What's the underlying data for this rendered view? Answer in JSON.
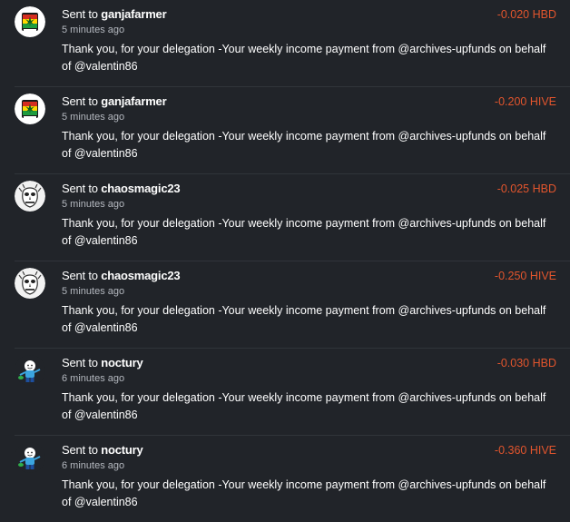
{
  "transactions": [
    {
      "prefix": "Sent to",
      "recipient": "ganjafarmer",
      "time": "5 minutes ago",
      "amount": "-0.020 HBD",
      "memo": "Thank you, for your delegation -Your weekly income payment from @archives-upfunds on behalf of @valentin86",
      "avatar": "ganjafarmer-avatar"
    },
    {
      "prefix": "Sent to",
      "recipient": "ganjafarmer",
      "time": "5 minutes ago",
      "amount": "-0.200 HIVE",
      "memo": "Thank you, for your delegation -Your weekly income payment from @archives-upfunds on behalf of @valentin86",
      "avatar": "ganjafarmer-avatar"
    },
    {
      "prefix": "Sent to",
      "recipient": "chaosmagic23",
      "time": "5 minutes ago",
      "amount": "-0.025 HBD",
      "memo": "Thank you, for your delegation -Your weekly income payment from @archives-upfunds on behalf of @valentin86",
      "avatar": "chaosmagic23-avatar"
    },
    {
      "prefix": "Sent to",
      "recipient": "chaosmagic23",
      "time": "5 minutes ago",
      "amount": "-0.250 HIVE",
      "memo": "Thank you, for your delegation -Your weekly income payment from @archives-upfunds on behalf of @valentin86",
      "avatar": "chaosmagic23-avatar"
    },
    {
      "prefix": "Sent to",
      "recipient": "noctury",
      "time": "6 minutes ago",
      "amount": "-0.030 HBD",
      "memo": "Thank you, for your delegation -Your weekly income payment from @archives-upfunds on behalf of @valentin86",
      "avatar": "noctury-avatar"
    },
    {
      "prefix": "Sent to",
      "recipient": "noctury",
      "time": "6 minutes ago",
      "amount": "-0.360 HIVE",
      "memo": "Thank you, for your delegation -Your weekly income payment from @archives-upfunds on behalf of @valentin86",
      "avatar": "noctury-avatar"
    }
  ],
  "colors": {
    "background": "#212429",
    "amount": "#e2552d",
    "divider": "#30343a",
    "muted": "#b4b8bf"
  }
}
